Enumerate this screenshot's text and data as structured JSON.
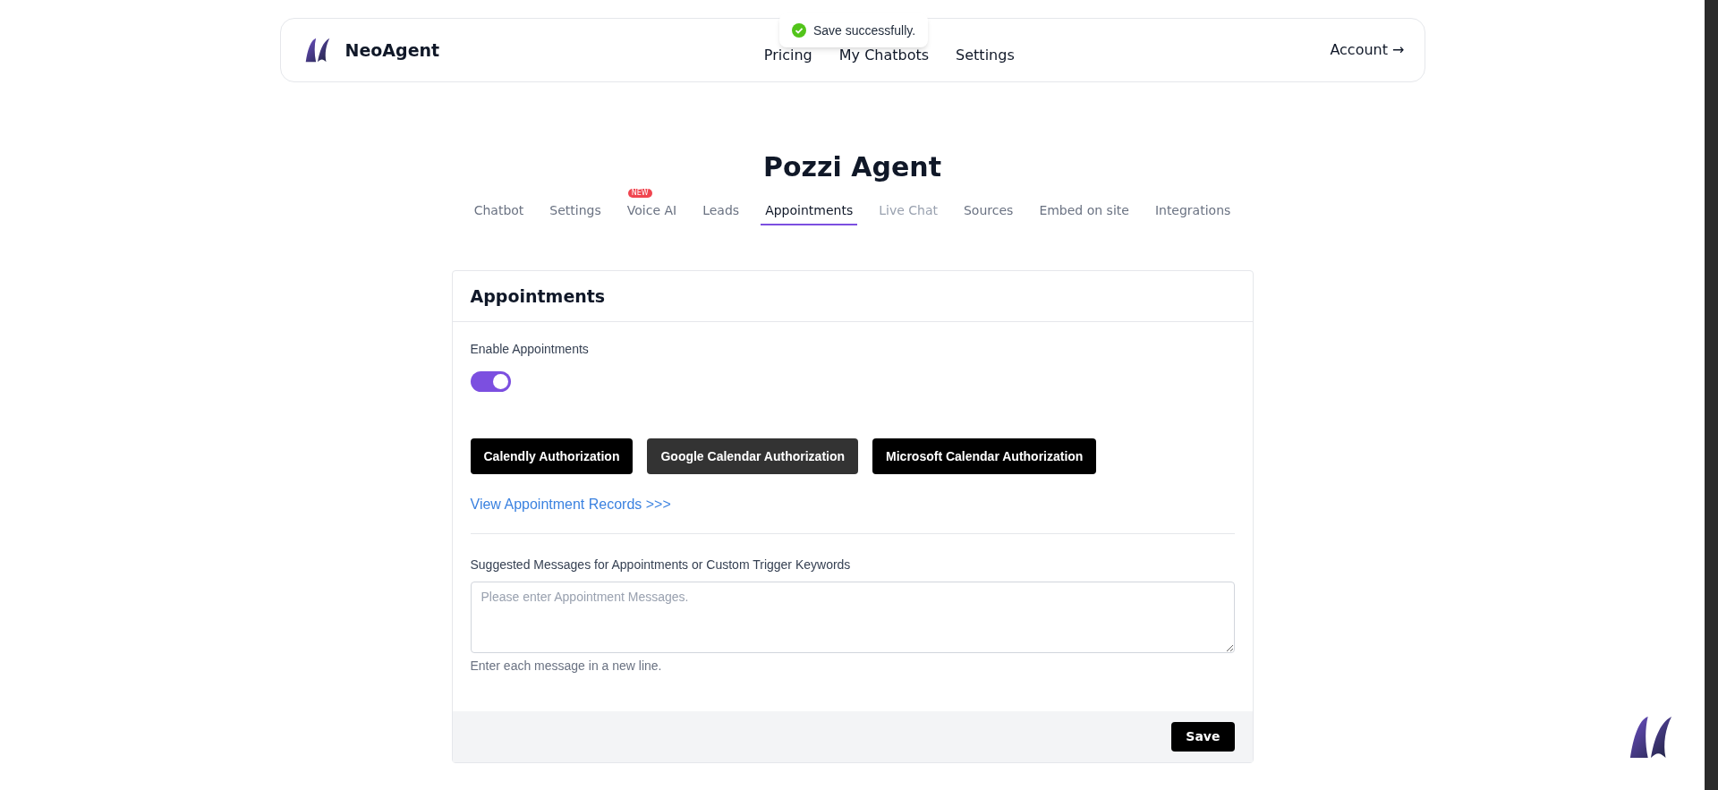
{
  "header": {
    "brand": "NeoAgent",
    "nav": [
      "Pricing",
      "My Chatbots",
      "Settings"
    ],
    "account": "Account →"
  },
  "toast": {
    "message": "Save successfully."
  },
  "title": "Pozzi Agent",
  "tabs": [
    {
      "label": "Chatbot",
      "selected": false,
      "disabled": false
    },
    {
      "label": "Settings",
      "selected": false,
      "disabled": false
    },
    {
      "label": "Voice AI",
      "selected": false,
      "disabled": false,
      "badge": "NEW"
    },
    {
      "label": "Leads",
      "selected": false,
      "disabled": false
    },
    {
      "label": "Appointments",
      "selected": true,
      "disabled": false
    },
    {
      "label": "Live Chat",
      "selected": false,
      "disabled": true
    },
    {
      "label": "Sources",
      "selected": false,
      "disabled": false
    },
    {
      "label": "Embed on site",
      "selected": false,
      "disabled": false
    },
    {
      "label": "Integrations",
      "selected": false,
      "disabled": false
    }
  ],
  "card": {
    "title": "Appointments",
    "toggle_label": "Enable Appointments",
    "enabled": true,
    "buttons": [
      {
        "label": "Calendly Authorization",
        "selected": false
      },
      {
        "label": "Google Calendar Authorization",
        "selected": true
      },
      {
        "label": "Microsoft Calendar Authorization",
        "selected": false
      }
    ],
    "link": "View Appointment Records >>>",
    "messages_label": "Suggested Messages for Appointments or Custom Trigger Keywords",
    "placeholder": "Please enter Appointment Messages.",
    "hint": "Enter each message in a new line.",
    "save": "Save"
  }
}
